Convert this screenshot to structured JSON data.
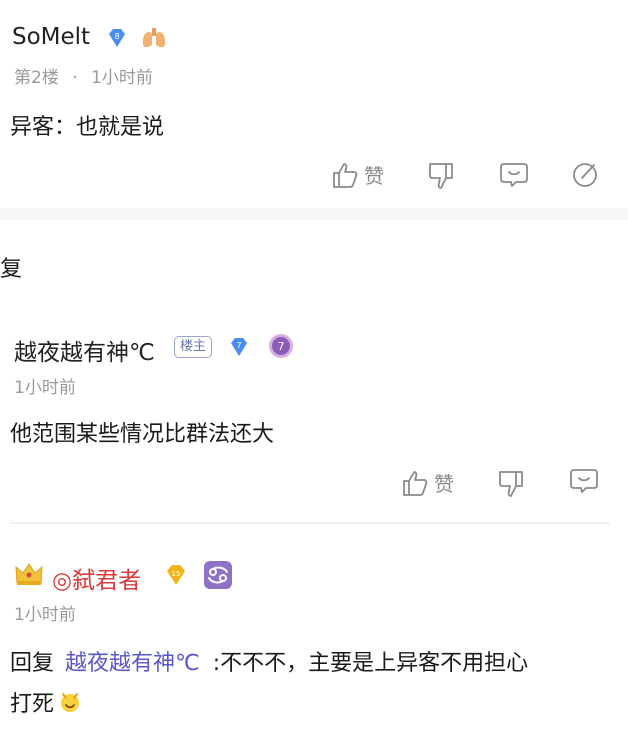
{
  "comments": [
    {
      "username": "SoMelt",
      "level": "8",
      "floor": "第2楼",
      "dot": "·",
      "time": "1小时前",
      "text": "异客：也就是说",
      "like_label": "赞"
    },
    {
      "username": "越夜越有神℃",
      "owner_badge": "楼主",
      "level": "7",
      "badge2": "7",
      "time": "1小时前",
      "text": "他范围某些情况比群法还大",
      "like_label": "赞"
    },
    {
      "username": "◎弑君者",
      "level": "15",
      "time": "1小时前",
      "reply_prefix": "回复",
      "mention": "越夜越有神℃",
      "reply_rest": ":不不不，主要是上异客不用担心",
      "reply_line2": "打死"
    }
  ],
  "partial_text": "复",
  "colors": {
    "accent": "#5a55c8",
    "meta": "#9a9a9a",
    "red_name": "#d93a3a"
  }
}
